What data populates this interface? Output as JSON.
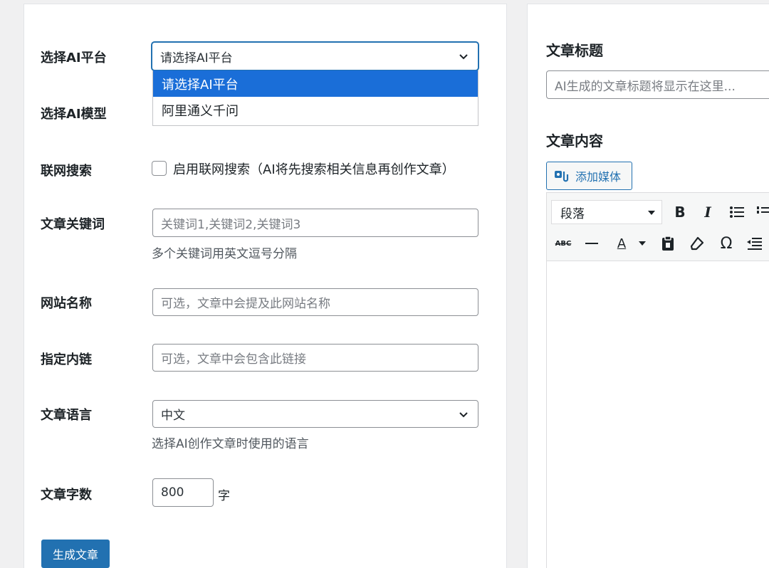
{
  "form": {
    "platform": {
      "label": "选择AI平台",
      "value": "请选择AI平台",
      "options": [
        "请选择AI平台",
        "阿里通义千问"
      ]
    },
    "model": {
      "label": "选择AI模型"
    },
    "web_search": {
      "label": "联网搜索",
      "checkbox_label": "启用联网搜索（AI将先搜索相关信息再创作文章）",
      "checked": false
    },
    "keywords": {
      "label": "文章关键词",
      "placeholder": "关键词1,关键词2,关键词3",
      "hint": "多个关键词用英文逗号分隔"
    },
    "site_name": {
      "label": "网站名称",
      "placeholder": "可选，文章中会提及此网站名称"
    },
    "internal_link": {
      "label": "指定内链",
      "placeholder": "可选，文章中会包含此链接"
    },
    "language": {
      "label": "文章语言",
      "value": "中文",
      "hint": "选择AI创作文章时使用的语言"
    },
    "word_count": {
      "label": "文章字数",
      "value": "800",
      "unit": "字"
    },
    "generate_button": "生成文章"
  },
  "article": {
    "title_label": "文章标题",
    "title_placeholder": "AI生成的文章标题将显示在这里...",
    "content_label": "文章内容",
    "add_media": "添加媒体",
    "toolbar": {
      "format_value": "段落",
      "bold": "B",
      "italic": "I",
      "strike": "ABC",
      "omega": "Ω",
      "text_color": "A"
    }
  },
  "colors": {
    "accent": "#2271b1",
    "dropdown_selected": "#1a6ed8",
    "background": "#f0f0f1"
  }
}
